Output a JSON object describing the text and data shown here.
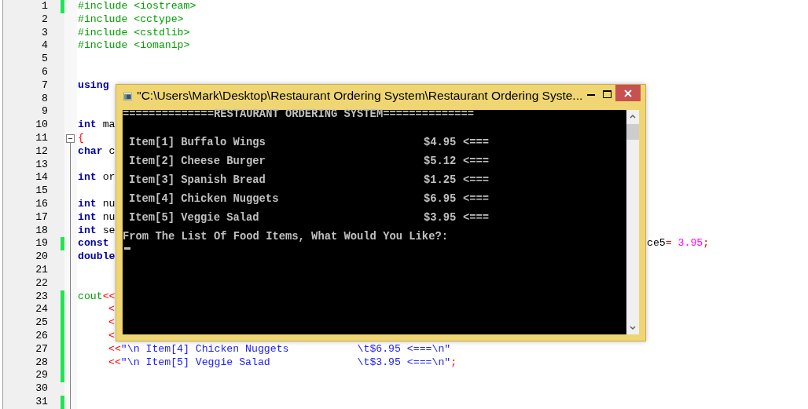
{
  "editor": {
    "lines": [
      {
        "n": "1",
        "changed": true,
        "tokens": [
          {
            "text": "#include <iostream>",
            "kind": "pre"
          }
        ]
      },
      {
        "n": "2",
        "changed": false,
        "tokens": [
          {
            "text": "#include <cctype>",
            "kind": "pre"
          }
        ]
      },
      {
        "n": "3",
        "changed": false,
        "tokens": [
          {
            "text": "#include <cstdlib>",
            "kind": "pre"
          }
        ]
      },
      {
        "n": "4",
        "changed": false,
        "tokens": [
          {
            "text": "#include <iomanip>",
            "kind": "pre"
          }
        ]
      },
      {
        "n": "5",
        "changed": false
      },
      {
        "n": "6",
        "changed": false
      },
      {
        "n": "7",
        "changed": false,
        "tokens": [
          {
            "text": "using",
            "kind": "kw"
          }
        ]
      },
      {
        "n": "8",
        "changed": false
      },
      {
        "n": "9",
        "changed": false
      },
      {
        "n": "10",
        "changed": false,
        "tokens": [
          {
            "text": "int",
            "kind": "kw"
          },
          {
            "text": "ma",
            "kind": "plain"
          }
        ]
      },
      {
        "n": "11",
        "changed": false,
        "fold": true,
        "tokens": [
          {
            "text": "{",
            "kind": "op"
          }
        ]
      },
      {
        "n": "12",
        "changed": false,
        "tokens": [
          {
            "text": "char",
            "kind": "kw"
          },
          {
            "text": "c",
            "kind": "plain"
          }
        ]
      },
      {
        "n": "13",
        "changed": false
      },
      {
        "n": "14",
        "changed": false,
        "tokens": [
          {
            "text": "int",
            "kind": "kw"
          },
          {
            "text": "or",
            "kind": "plain"
          }
        ]
      },
      {
        "n": "15",
        "changed": false
      },
      {
        "n": "16",
        "changed": false,
        "tokens": [
          {
            "text": "int",
            "kind": "kw"
          },
          {
            "text": "nu",
            "kind": "plain"
          }
        ]
      },
      {
        "n": "17",
        "changed": false,
        "tokens": [
          {
            "text": "int",
            "kind": "kw"
          },
          {
            "text": "nu",
            "kind": "plain"
          }
        ]
      },
      {
        "n": "18",
        "changed": false,
        "tokens": [
          {
            "text": "int",
            "kind": "kw"
          },
          {
            "text": "se",
            "kind": "plain"
          }
        ]
      },
      {
        "n": "19",
        "changed": true,
        "tokens": [
          {
            "text": "const",
            "kind": "kw"
          }
        ],
        "right": [
          {
            "text": "ce5",
            "kind": "plain"
          },
          {
            "text": "=",
            "kind": "op"
          },
          {
            "text": "3.95",
            "kind": "num"
          },
          {
            "text": ";",
            "kind": "op"
          }
        ]
      },
      {
        "n": "20",
        "changed": false,
        "tokens": [
          {
            "text": "double",
            "kind": "kw"
          }
        ]
      },
      {
        "n": "21",
        "changed": false
      },
      {
        "n": "22",
        "changed": false
      },
      {
        "n": "23",
        "changed": true,
        "tokens": [
          {
            "text": "cout",
            "kind": "pre"
          },
          {
            "text": "<<",
            "kind": "op"
          }
        ]
      },
      {
        "n": "24",
        "changed": true,
        "indent": true,
        "tokens": [
          {
            "text": "<",
            "kind": "op"
          }
        ]
      },
      {
        "n": "25",
        "changed": true,
        "indent": true,
        "tokens": [
          {
            "text": "<",
            "kind": "op"
          }
        ]
      },
      {
        "n": "26",
        "changed": true,
        "indent": true,
        "tokens": [
          {
            "text": "<",
            "kind": "op"
          }
        ]
      },
      {
        "n": "27",
        "changed": true,
        "indent": true,
        "tokens": [
          {
            "text": "<<",
            "kind": "op"
          },
          {
            "text": "\"\\n Item[4] Chicken Nuggets           \\t$6.95 <===\\n\"",
            "kind": "str"
          }
        ]
      },
      {
        "n": "28",
        "changed": true,
        "indent": true,
        "tokens": [
          {
            "text": "<<",
            "kind": "op"
          },
          {
            "text": "\"\\n Item[5] Veggie Salad              \\t$3.95 <===\\n\"",
            "kind": "str"
          },
          {
            "text": ";",
            "kind": "op"
          }
        ]
      },
      {
        "n": "29",
        "changed": true
      },
      {
        "n": "30",
        "changed": false
      },
      {
        "n": "31",
        "changed": true
      }
    ]
  },
  "console": {
    "title": "\"C:\\Users\\Mark\\Desktop\\Restaurant Ordering System\\Restaurant Ordering Syste...",
    "header": "==============RESTAURANT ORDERING SYSTEM==============",
    "items": [
      {
        "label": "Item[1] Buffalo Wings",
        "price": "$4.95",
        "arrow": "<==="
      },
      {
        "label": "Item[2] Cheese Burger",
        "price": "$5.12",
        "arrow": "<==="
      },
      {
        "label": "Item[3] Spanish Bread",
        "price": "$1.25",
        "arrow": "<==="
      },
      {
        "label": "Item[4] Chicken Nuggets",
        "price": "$6.95",
        "arrow": "<==="
      },
      {
        "label": "Item[5] Veggie Salad",
        "price": "$3.95",
        "arrow": "<==="
      }
    ],
    "prompt": "From The List Of Food Items, What Would You Like?:"
  }
}
